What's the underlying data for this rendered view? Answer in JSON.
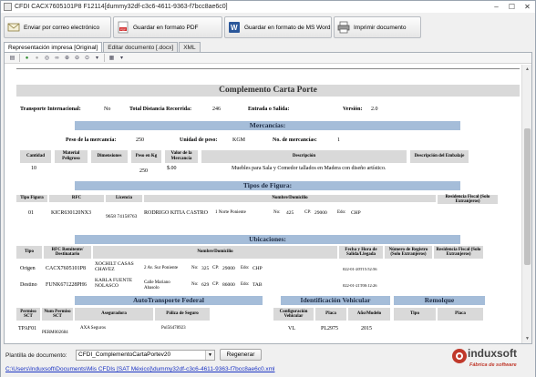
{
  "window": {
    "title": "CFDI CACX7605101P8 F12114[dummy32df-c3c6-4611-9363-f7bcc8ae6c0]",
    "minimize": "–",
    "maximize": "☐",
    "close": "✕"
  },
  "toolbar": {
    "email": "Enviar por correo electrónico",
    "pdf": "Guardar en formato PDF",
    "word": "Guardar en formato de MS Word",
    "print": "Imprimir documento"
  },
  "tabs": [
    "Representación impresa [Original]",
    "Editar documento [.docx]",
    "XML"
  ],
  "doc": {
    "title": "Complemento Carta Porte",
    "general": {
      "transporte_label": "Transporte Internacional:",
      "transporte": "No",
      "distancia_label": "Total Distancia Recorrida:",
      "distancia": "246",
      "entrada_label": "Entrada o Salida:",
      "version_label": "Versión:",
      "version": "2.0"
    },
    "mercancias": {
      "header": "Mercancías:",
      "peso_label": "Peso de la mercancía:",
      "peso": "250",
      "unidad_label": "Unidad de peso:",
      "unidad": "KGM",
      "num_label": "No. de mercancías:",
      "num": "1",
      "columns": [
        "Cantidad",
        "Material Peligroso",
        "Dimensiones",
        "Peso en Kg",
        "Valor de la Mercancía",
        "Descripción",
        "Descripción del Embalaje"
      ],
      "row": {
        "cantidad": "10",
        "peso": "250",
        "valor": "$.00",
        "descripcion": "Muebles para Sala y Comedor tallados en Madera con diseño artístico."
      }
    },
    "figura": {
      "header": "Tipos de Figura:",
      "columns": [
        "Tipo Figura",
        "RFC",
        "Licencia",
        "Nombre/Domicilio",
        "Residencia Fiscal (Solo Extranjeros)"
      ],
      "row": {
        "tipo": "01",
        "rfc": "KICR630120NX3",
        "licencia": "9658 74158763",
        "nombre": "RODRIGO KITIA CASTRO",
        "calle": "1 Norte Poniente",
        "no_label": "No:",
        "no": "425",
        "cp_label": "CP:",
        "cp": "29000",
        "edo_label": "Edo:",
        "edo": "CHP"
      }
    },
    "ubicaciones": {
      "header": "Ubicaciones:",
      "columns": [
        "Tipo",
        "RFC Remitente/ Destinatario",
        "Nombre/Domicilio",
        "Fecha y Hora de Salida/Llegada",
        "Número de Registro (Solo Extranjeros)",
        "Residencia Fiscal (Solo Extranjeros)"
      ],
      "rows": [
        {
          "tipo": "Origen",
          "rfc": "CACX7605101P8",
          "nombre": "XOCHILT CASAS CHAVEZ",
          "calle": "2 Av. Sur Poniente",
          "no_label": "No:",
          "no": "325",
          "cp_label": "CP:",
          "cp": "29000",
          "edo_label": "Edo:",
          "edo": "CHP",
          "fecha": "022-01-20T15:52:56"
        },
        {
          "tipo": "Destino",
          "rfc": "FUNK671228PH6",
          "nombre": "KARLA FUENTE NOLASCO",
          "calle": "Calle Mariano Abasolo",
          "no_label": "No:",
          "no": "629",
          "cp_label": "CP:",
          "cp": "86000",
          "edo_label": "Edo:",
          "edo": "TAB",
          "fecha": "022-01-21T00:12:26"
        }
      ]
    },
    "autotransporte": {
      "header": "AutoTransporte Federal",
      "columns": [
        "Permiso SCT",
        "Num Permiso SCT",
        "Aseguradora",
        "Póliza de Seguro"
      ],
      "row": {
        "permiso": "TPAF01",
        "num": "PERM002684",
        "aseguradora": "AXA Seguros",
        "poliza": "Pol56478923"
      }
    },
    "vehicular": {
      "header": "Identificación Vehicular",
      "columns": [
        "Configuración Vehicular",
        "Placa",
        "Año/Modelo"
      ],
      "row": {
        "config": "VL",
        "placa": "PL2975",
        "anio": "2015"
      }
    },
    "remolque": {
      "header": "Remolque",
      "columns": [
        "Tipo",
        "Placa"
      ]
    }
  },
  "bottom": {
    "plantilla_label": "Plantilla de documento:",
    "plantilla": "CFDI_ComplementoCartaPortev20",
    "regenerar": "Regenerar",
    "path": "C:\\Users\\Induxsoft\\Documents\\Mis CFDIs [SAT México]\\dummy32df-c3c6-4611-9363-f7bcc8ae6c0.xml"
  },
  "logo": {
    "brand": "induxsoft",
    "tagline": "Fábrica de software"
  }
}
